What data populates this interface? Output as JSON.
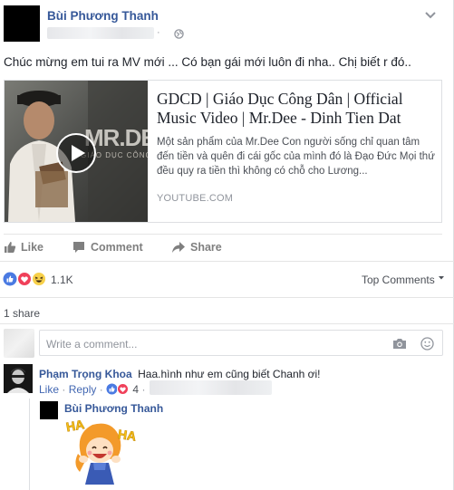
{
  "post": {
    "author_name": "Bùi Phương Thanh",
    "text": "Chúc mừng em tui ra MV mới ... Có bạn gái mới luôn đi nha.. Chị biết r đó..",
    "meta_separator": "·"
  },
  "link_preview": {
    "title": "GDCD | Giáo Dục Công Dân | Official Music Video | Mr.Dee - Dinh Tien Dat",
    "description": "Một sản phẩm của Mr.Dee Con người sống chỉ quan tâm đến tiền và quên đi cái gốc của mình đó là Đạo Đức Mọi thứ đều quy ra tiền thì không có chỗ cho Lương...",
    "domain": "YOUTUBE.COM",
    "thumb_overlay_text": "MR.DEE",
    "thumb_sub_text": "GIÁO DỤC CÔNG"
  },
  "actions": {
    "like": "Like",
    "comment": "Comment",
    "share": "Share"
  },
  "reactions": {
    "count": "1.1K",
    "types": [
      "like",
      "love",
      "haha"
    ],
    "sort_label": "Top Comments"
  },
  "shares": "1 share",
  "comment_input": {
    "placeholder": "Write a comment..."
  },
  "comments": [
    {
      "author": "Phạm Trọng Khoa",
      "text": "Haa.hình như em cũng biết Chanh ơi!",
      "like_label": "Like",
      "reply_label": "Reply",
      "reaction_count": "4",
      "separator": "·"
    }
  ],
  "reply": {
    "author": "Bùi Phương Thanh",
    "sticker_text": "HA"
  },
  "colors": {
    "link_blue": "#365899",
    "action_blue": "#4267b2",
    "muted": "#90949c"
  }
}
